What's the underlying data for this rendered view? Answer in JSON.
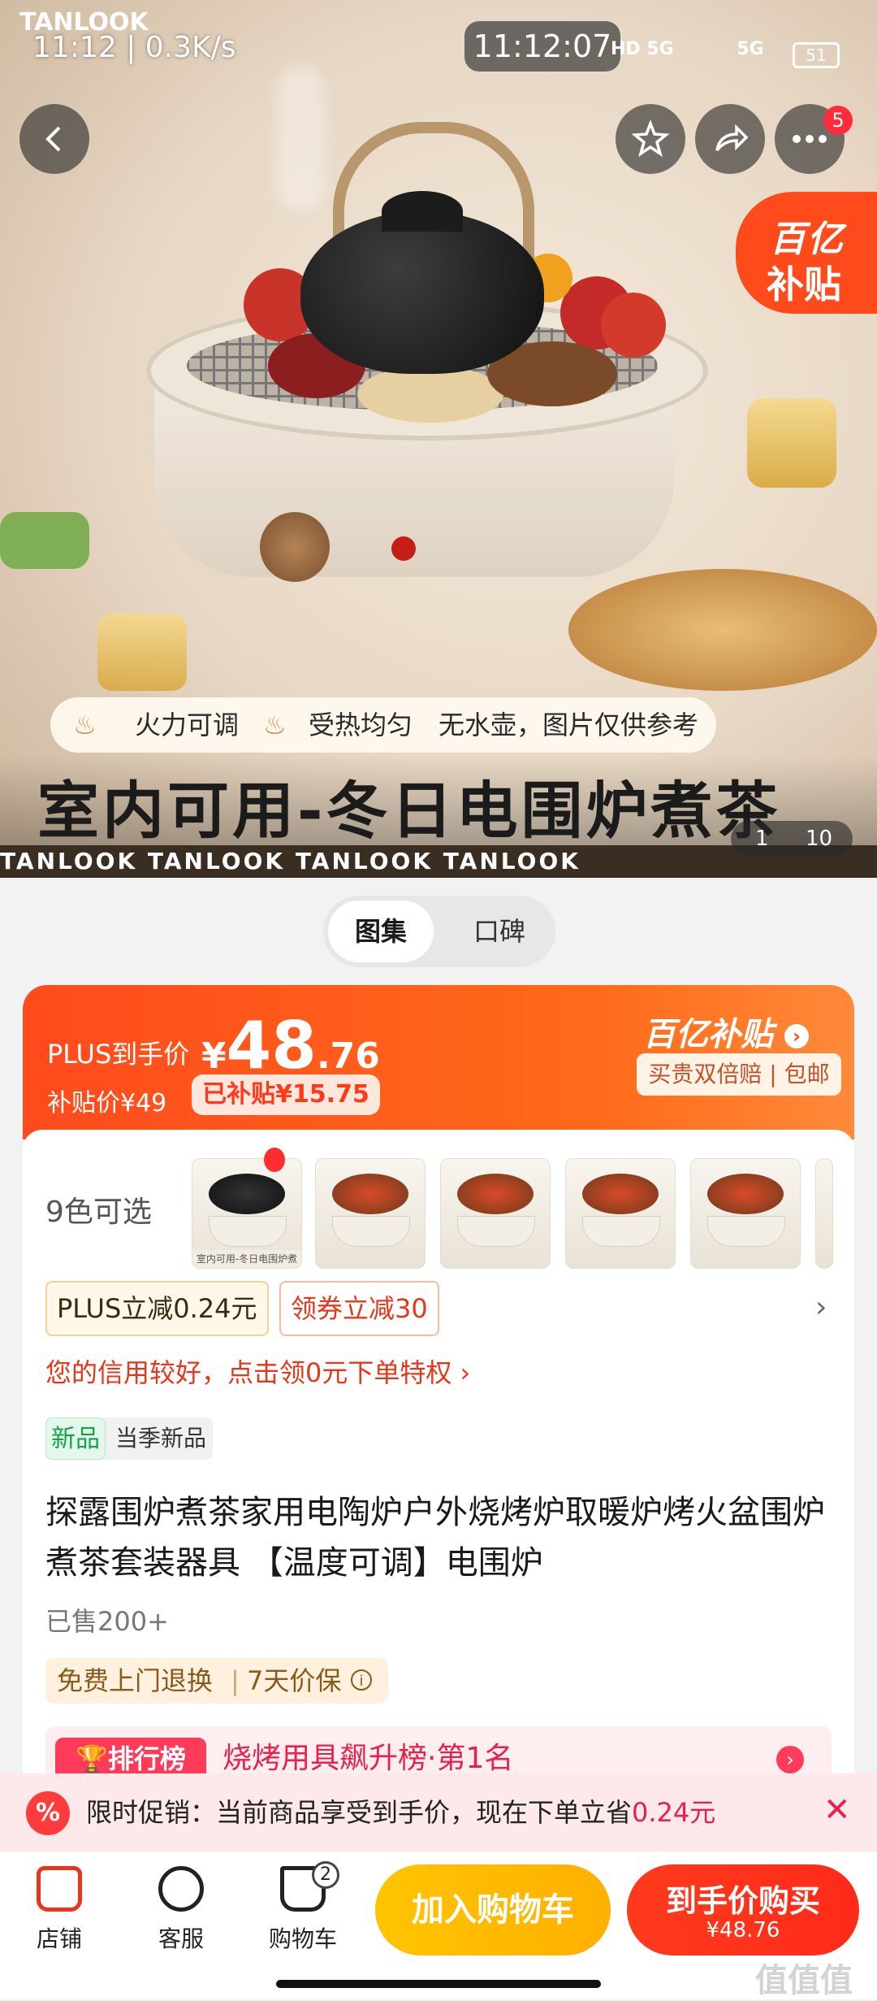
{
  "status_bar": {
    "left_text": "11:12 | 0.3K/s",
    "time": "11:12:07",
    "net1": "HD 5G",
    "net2": "5G",
    "battery": "51"
  },
  "hero": {
    "brand_logo": "TANLOOK",
    "badge_count": "5",
    "subsidy_tag": [
      "百亿",
      "补贴"
    ],
    "features": [
      "火力可调",
      "受热均匀",
      "无水壶，图片仅供参考"
    ],
    "headline": "室内可用-冬日电围炉煮茶",
    "strip_text": "TANLOOK   TANLOOK   TANLOOK   TANLOOK",
    "counter": [
      "1",
      "10"
    ]
  },
  "tabs": [
    "图集",
    "口碑"
  ],
  "price": {
    "plus_label": "PLUS到手价",
    "currency": "¥",
    "integer": "48",
    "decimal": ".76",
    "subsidy_price": "补贴价¥49",
    "subsidized": "已补贴¥15.75",
    "brand": "百亿补贴",
    "guarantee": "买贵双倍赔 | 包邮"
  },
  "colors": {
    "label": "9色可选",
    "thumbs": [
      "室内可用-冬日电围炉煮茶",
      "",
      "",
      "",
      ""
    ]
  },
  "coupons": [
    "PLUS立减0.24元",
    "领券立减30"
  ],
  "credit_text": "您的信用较好，点击领0元下单特权 ›",
  "new_tag": {
    "badge": "新品",
    "text": "当季新品"
  },
  "product_title": "探露围炉煮茶家用电陶炉户外烧烤炉取暖炉烤火盆围炉煮茶套装器具 【温度可调】电围炉",
  "sold": "已售200+",
  "service": {
    "return": "免费上门退换",
    "price_protect": "7天价保",
    "info": "i"
  },
  "rank": {
    "badge": "排行榜",
    "text": "烧烤用具飙升榜·第1名"
  },
  "promo": {
    "icon": "%",
    "text": "限时促销：当前商品享受到手价，现在下单立省",
    "amount": "0.24元"
  },
  "bottom": {
    "store": "店铺",
    "service": "客服",
    "cart": "购物车",
    "cart_count": "2",
    "add_to_cart": "加入购物车",
    "buy_now": "到手价购买",
    "buy_price": "¥48.76"
  },
  "watermark": "值值值",
  "colors_theme": {
    "accent": "#ff4a1c",
    "yellow": "#ffc400",
    "red": "#ff2a1a"
  }
}
